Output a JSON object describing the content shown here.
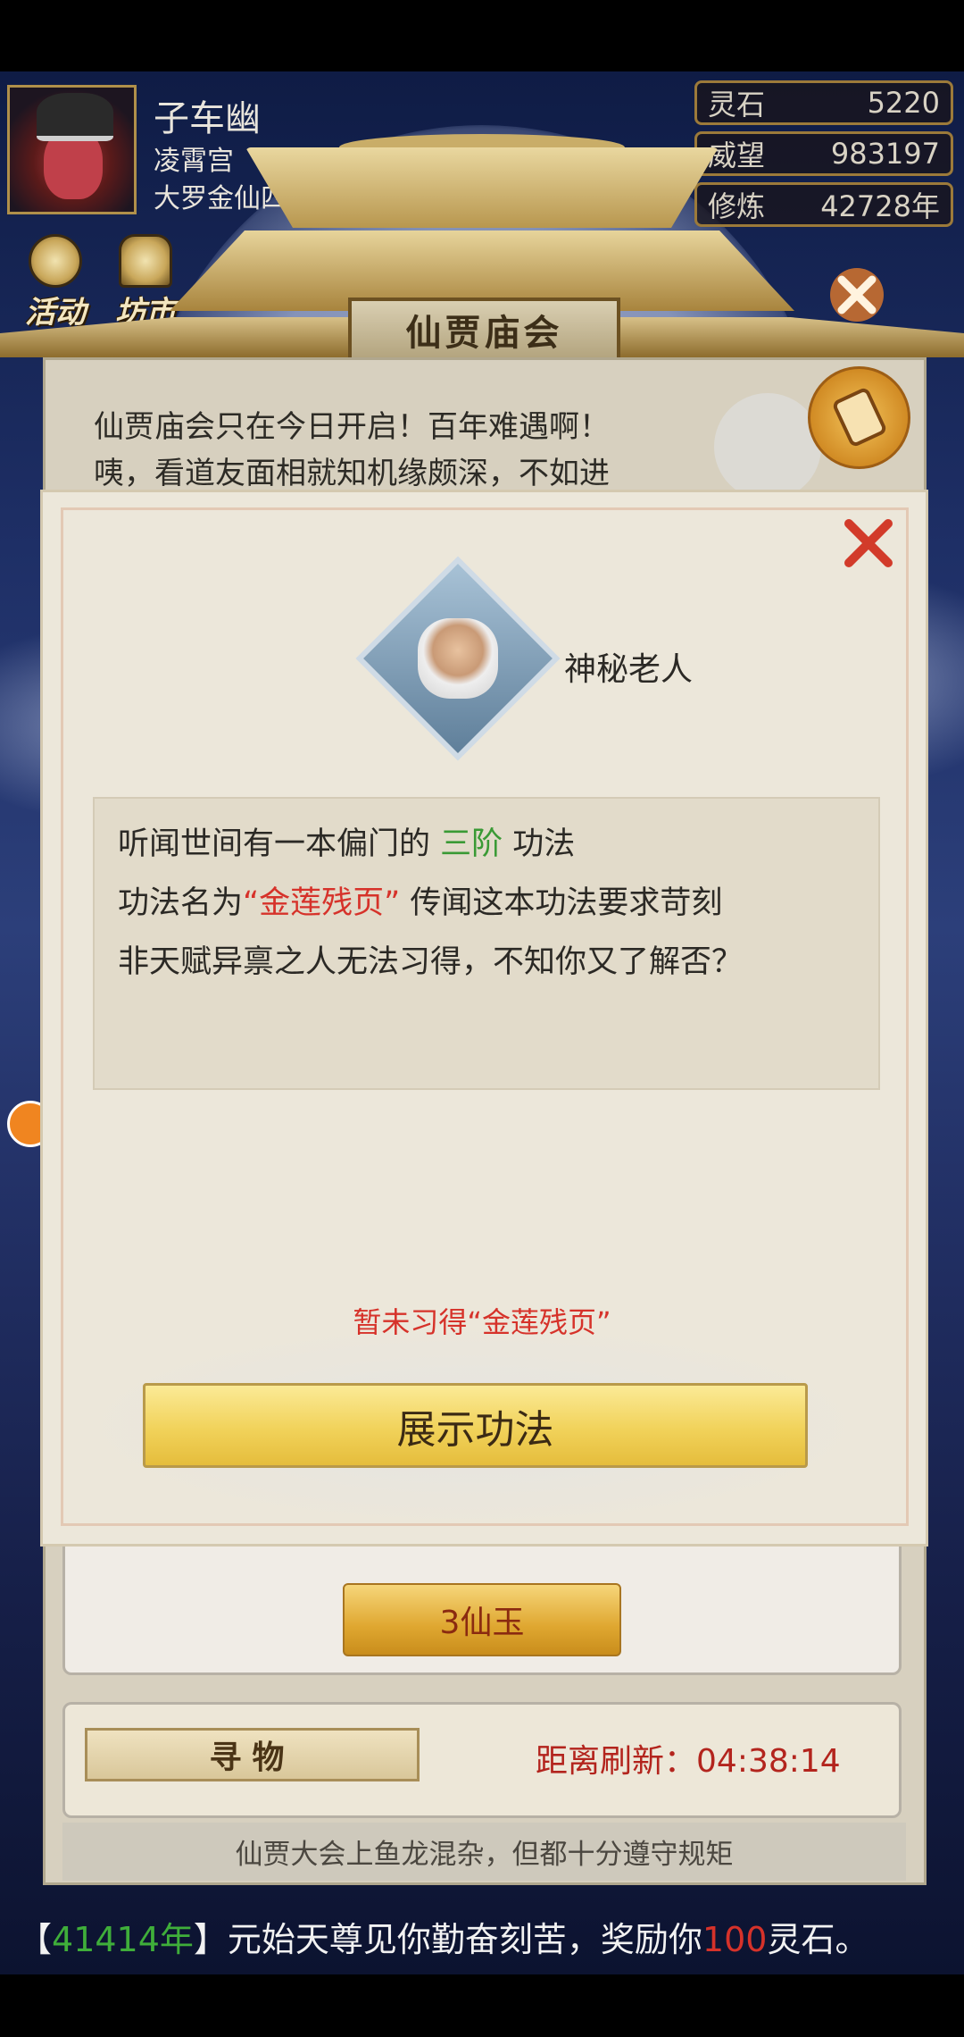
{
  "player": {
    "name": "子车幽",
    "sect": "凌霄宫",
    "rank": "大罗金仙四阶"
  },
  "stats": [
    {
      "label": "灵石",
      "value": "5220"
    },
    {
      "label": "威望",
      "value": "983197"
    },
    {
      "label": "修炼",
      "value": "42728年"
    }
  ],
  "hud": {
    "activity_label": "活动",
    "market_label": "坊市"
  },
  "event": {
    "title": "仙贾庙会",
    "intro_line1": "仙贾庙会只在今日开启！百年难遇啊！",
    "intro_line2": "咦，看道友面相就知机缘颇深，不如进",
    "price_label": "3仙玉",
    "search_title": "寻物",
    "refresh_label": "距离刷新：",
    "refresh_time": "04:38:14",
    "hint": "仙贾大会上鱼龙混杂，但都十分遵守规矩"
  },
  "modal": {
    "npc_name": "神秘老人",
    "dialog": {
      "line1_prefix": "听闻世间有一本偏门的 ",
      "line1_grade": "三阶",
      "line1_suffix": " 功法",
      "line2_prefix": "功法名为",
      "line2_name": "“金莲残页”",
      "line2_suffix": " 传闻这本功法要求苛刻",
      "line3": "非天赋异禀之人无法习得，不知你又了解否？"
    },
    "status": "暂未习得“金莲残页”",
    "button_label": "展示功法"
  },
  "chat": {
    "year": "41414年",
    "prefix": "【",
    "mid": "】元始天尊见你勤奋刻苦，奖励你",
    "amount": "100",
    "suffix": "灵石。"
  },
  "colors": {
    "grade_green": "#3a9a35",
    "name_red": "#d6322a",
    "status_red": "#d6322a",
    "button_gold": "#f1d25a"
  }
}
